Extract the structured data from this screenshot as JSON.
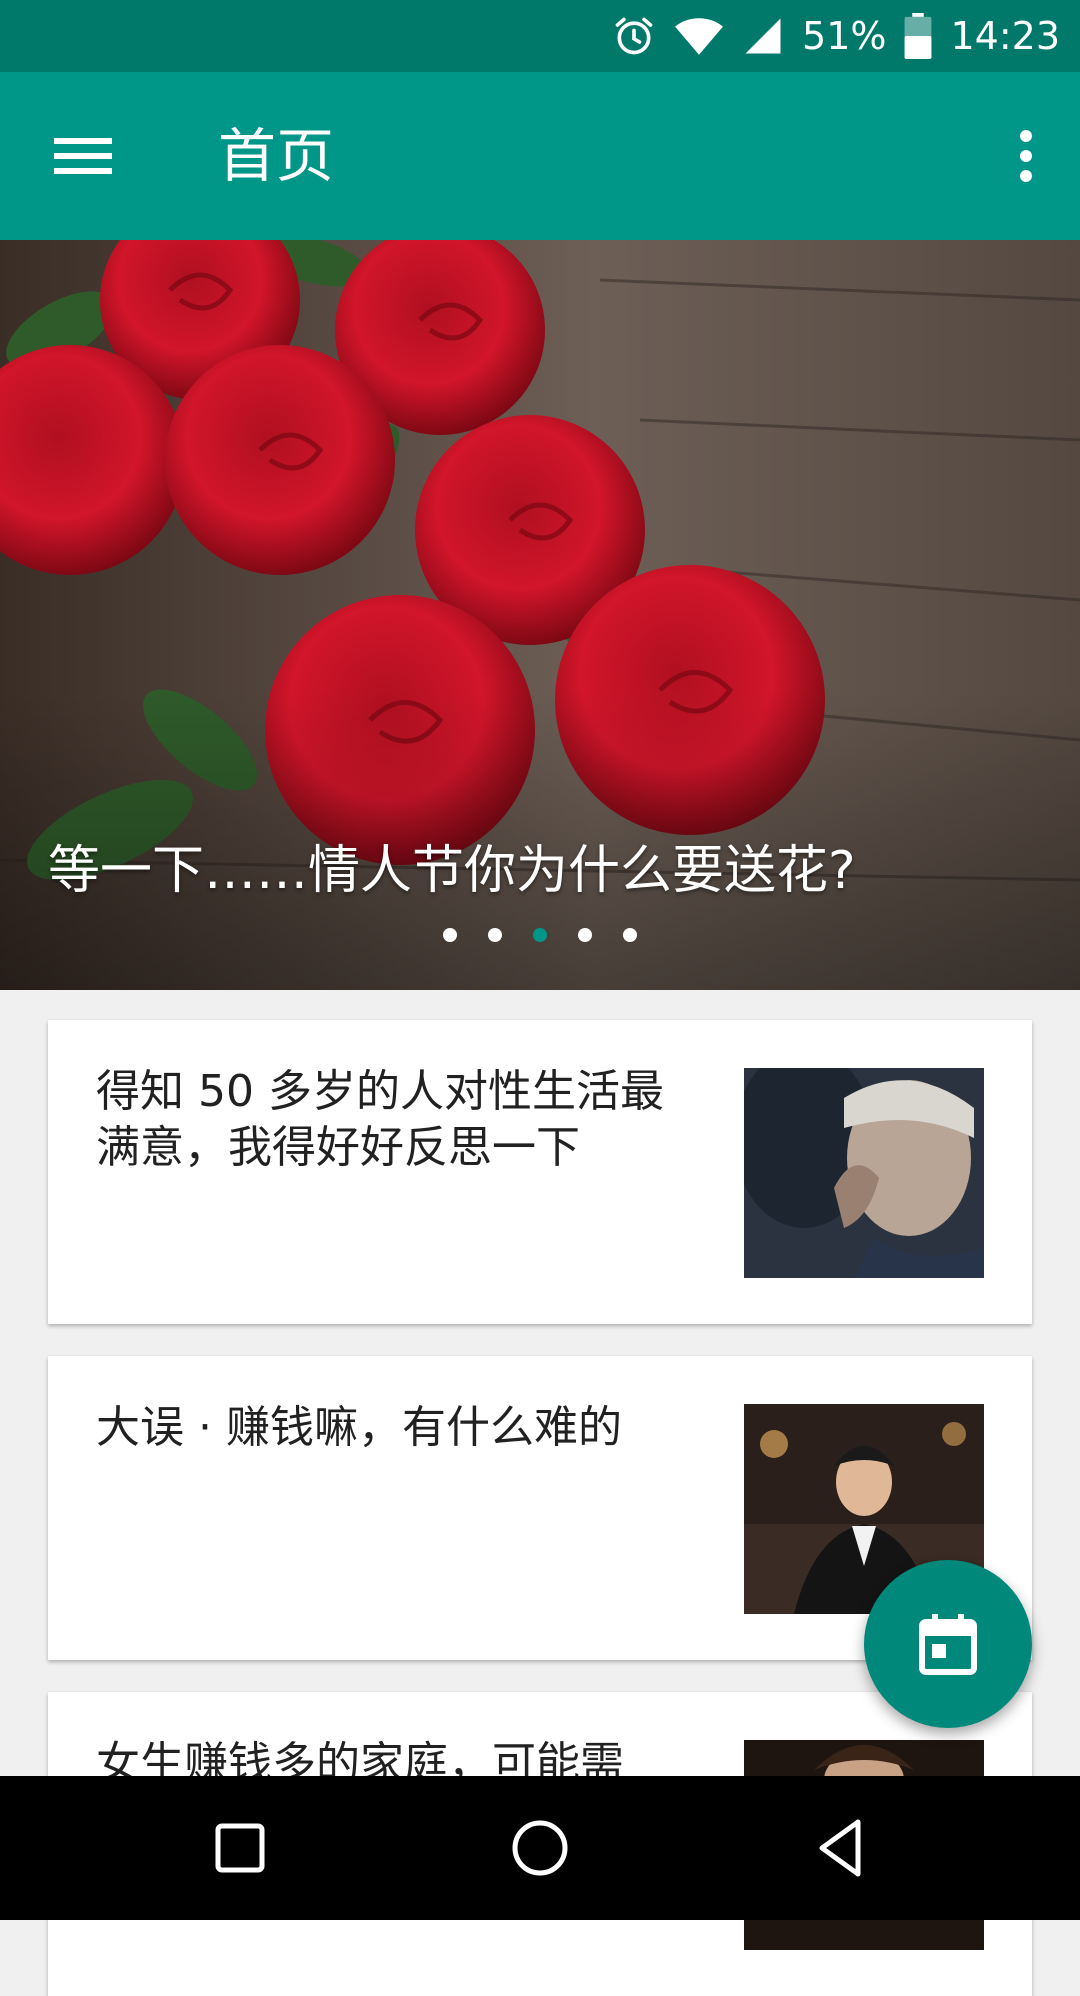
{
  "status_bar": {
    "battery": "51%",
    "time": "14:23",
    "icons": [
      "alarm-icon",
      "wifi-icon",
      "signal-icon",
      "battery-icon"
    ]
  },
  "app_bar": {
    "title": "首页",
    "icons": [
      "menu-icon",
      "more-vert-icon"
    ],
    "color": "#009688"
  },
  "banner": {
    "title": "等一下……情人节你为什么要送花?",
    "total_slides": 5,
    "active_slide": 3,
    "image": "red-roses-photo"
  },
  "articles": [
    {
      "title": "得知 50 多岁的人对性生活最满意，我得好好反思一下",
      "thumbnail": "elderly-woman-photo"
    },
    {
      "title": "大误 · 赚钱嘛，有什么难的",
      "thumbnail": "man-in-suit-photo"
    },
    {
      "title": "女生赚钱多的家庭，可能需",
      "thumbnail": "portrait-photo"
    }
  ],
  "fab": {
    "icon": "calendar-icon"
  },
  "nav_bar": {
    "icons": [
      "recent-apps-icon",
      "home-icon",
      "back-icon"
    ]
  }
}
